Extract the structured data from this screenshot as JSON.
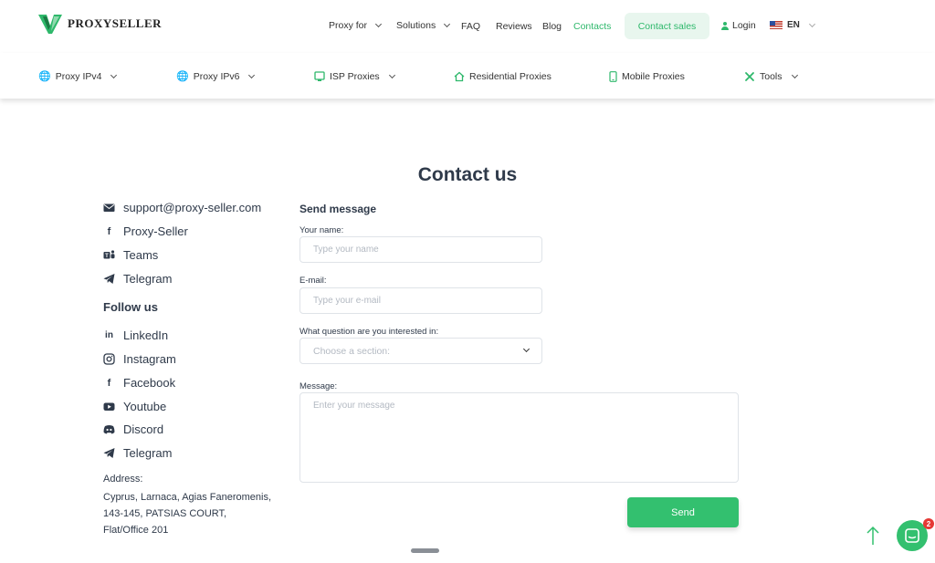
{
  "header": {
    "logo_text": "PROXYSELLER",
    "nav": [
      {
        "label": "Proxy for",
        "dropdown": true
      },
      {
        "label": "Solutions",
        "dropdown": true
      },
      {
        "label": "FAQ"
      },
      {
        "label": "Reviews"
      },
      {
        "label": "Blog"
      },
      {
        "label": "Contacts",
        "active": true
      }
    ],
    "contact_sales": "Contact sales",
    "login": "Login",
    "language": "EN"
  },
  "subnav": [
    {
      "label": "Proxy IPv4",
      "icon": "globe-icon"
    },
    {
      "label": "Proxy IPv6",
      "icon": "globe-icon"
    },
    {
      "label": "ISP Proxies",
      "icon": "isp-icon"
    },
    {
      "label": "Residential Proxies",
      "icon": "home-icon"
    },
    {
      "label": "Mobile Proxies",
      "icon": "phone-icon"
    },
    {
      "label": "Tools",
      "icon": "tools-icon"
    }
  ],
  "page": {
    "title": "Contact us"
  },
  "contacts": {
    "items": [
      {
        "label": "support@proxy-seller.com",
        "icon": "email-icon"
      },
      {
        "label": "Proxy-Seller",
        "icon": "facebook-icon"
      },
      {
        "label": "Teams",
        "icon": "teams-icon"
      },
      {
        "label": "Telegram",
        "icon": "telegram-icon"
      }
    ],
    "follow_title": "Follow us",
    "social": [
      {
        "label": "LinkedIn",
        "icon": "linkedin-icon"
      },
      {
        "label": "Instagram",
        "icon": "instagram-icon"
      },
      {
        "label": "Facebook",
        "icon": "facebook-icon"
      },
      {
        "label": "Youtube",
        "icon": "youtube-icon"
      },
      {
        "label": "Discord",
        "icon": "discord-icon"
      },
      {
        "label": "Telegram",
        "icon": "telegram-icon"
      }
    ],
    "address_label": "Address:",
    "address_lines": [
      "Cyprus, Larnaca, Agias Faneromenis,",
      "143-145, PATSIAS COURT,",
      "Flat/Office 201"
    ]
  },
  "form": {
    "title": "Send message",
    "name_label": "Your name:",
    "name_placeholder": "Type your name",
    "email_label": "E-mail:",
    "email_placeholder": "Type your e-mail",
    "question_label": "What question are you interested in:",
    "question_placeholder": "Choose a section:",
    "message_label": "Message:",
    "message_placeholder": "Enter your message",
    "send_label": "Send"
  },
  "chat": {
    "badge_count": "2"
  },
  "colors": {
    "accent": "#33c06f",
    "text": "#2f3a4a",
    "badge": "#e53935"
  }
}
